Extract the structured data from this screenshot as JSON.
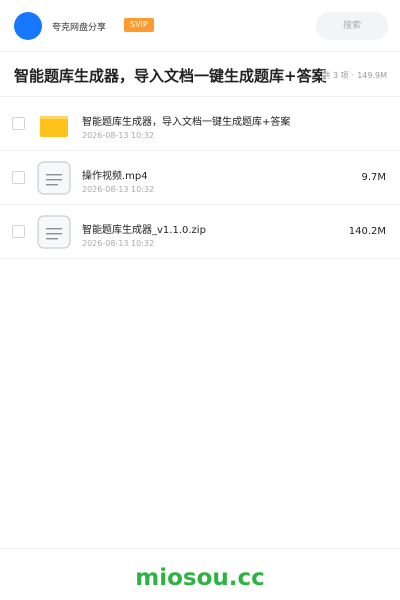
{
  "header": {
    "app_name": "夸克网盘分享",
    "badge": "SVIP",
    "search_placeholder": "搜索"
  },
  "share": {
    "title": "智能题库生成器，导入文档一键生成题库+答案",
    "item_count": "共 3 项",
    "separator": "·",
    "total_size": "149.9M"
  },
  "files": [
    {
      "name": "智能题库生成器，导入文档一键生成题库+答案",
      "date": "2026-08-13 10:32",
      "size": "",
      "icon": "folder-icon"
    },
    {
      "name": "操作视频.mp4",
      "date": "2026-08-13 10:32",
      "size": "9.7M",
      "icon": "file-icon"
    },
    {
      "name": "智能题库生成器_v1.1.0.zip",
      "date": "2026-08-13 10:32",
      "size": "140.2M",
      "icon": "file-icon"
    }
  ],
  "footer": {
    "watermark": "miosou.cc"
  },
  "colors": {
    "brand_blue": "#1677ff",
    "svip_orange": "#ff9a2e",
    "folder_yellow": "#ffc21a",
    "watermark_green": "#2fb244"
  }
}
